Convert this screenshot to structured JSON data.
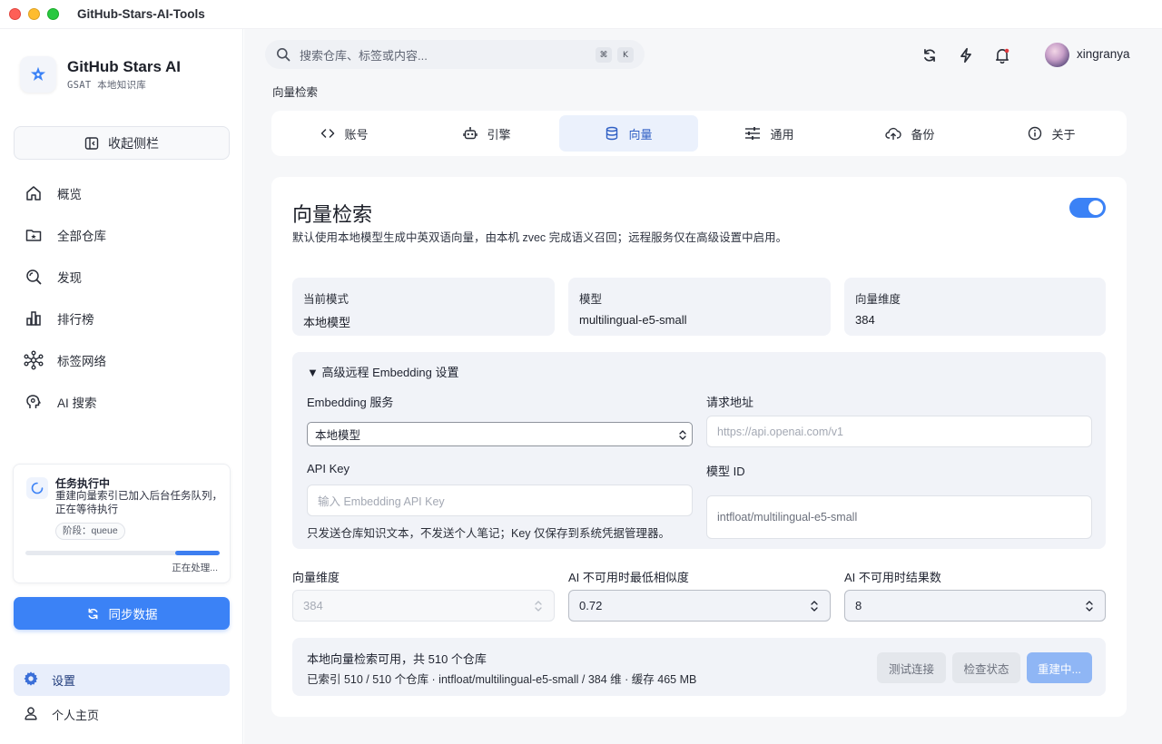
{
  "window": {
    "title": "GitHub-Stars-AI-Tools"
  },
  "brand": {
    "name": "GitHub Stars AI",
    "subtitle": "GSAT 本地知识库",
    "icon": "star-sparkle-icon"
  },
  "sidebar": {
    "collapse_label": "收起侧栏",
    "items": [
      {
        "label": "概览",
        "icon": "home-icon"
      },
      {
        "label": "全部仓库",
        "icon": "folder-star-icon"
      },
      {
        "label": "发现",
        "icon": "discover-search-icon"
      },
      {
        "label": "排行榜",
        "icon": "bar-chart-icon"
      },
      {
        "label": "标签网络",
        "icon": "network-icon"
      },
      {
        "label": "AI 搜索",
        "icon": "ai-brain-icon"
      }
    ],
    "task": {
      "title": "任务执行中",
      "description": "重建向量索引已加入后台任务队列，正在等待执行",
      "stage": "阶段：queue",
      "status": "正在处理..."
    },
    "sync_label": "同步数据",
    "bottom": [
      {
        "label": "设置",
        "icon": "gear-icon",
        "active": true
      },
      {
        "label": "个人主页",
        "icon": "user-icon",
        "active": false
      }
    ]
  },
  "topbar": {
    "search_placeholder": "搜索仓库、标签或内容...",
    "shortcut_mod": "⌘",
    "shortcut_key": "K",
    "username": "xingranya"
  },
  "breadcrumb": "向量检索",
  "tabs": [
    {
      "label": "账号",
      "icon": "code-icon"
    },
    {
      "label": "引擎",
      "icon": "robot-icon"
    },
    {
      "label": "向量",
      "icon": "database-icon",
      "active": true
    },
    {
      "label": "通用",
      "icon": "sliders-icon"
    },
    {
      "label": "备份",
      "icon": "cloud-upload-icon"
    },
    {
      "label": "关于",
      "icon": "info-icon"
    }
  ],
  "panel": {
    "title": "向量检索",
    "description": "默认使用本地模型生成中英双语向量，由本机 zvec 完成语义召回；远程服务仅在高级设置中启用。",
    "enabled": true,
    "stats": [
      {
        "label": "当前模式",
        "value": "本地模型"
      },
      {
        "label": "模型",
        "value": "multilingual-e5-small"
      },
      {
        "label": "向量维度",
        "value": "384"
      }
    ],
    "advanced": {
      "summary": "▼ 高级远程 Embedding 设置",
      "service_label": "Embedding 服务",
      "service_value": "本地模型",
      "url_label": "请求地址",
      "url_placeholder": "https://api.openai.com/v1",
      "apikey_label": "API Key",
      "apikey_placeholder": "输入 Embedding API Key",
      "model_label": "模型 ID",
      "model_value": "intfloat/multilingual-e5-small",
      "note": "只发送仓库知识文本，不发送个人笔记；Key 仅保存到系统凭据管理器。"
    },
    "numbers": [
      {
        "label": "向量维度",
        "value": "384",
        "disabled": true
      },
      {
        "label": "AI 不可用时最低相似度",
        "value": "0.72",
        "disabled": false
      },
      {
        "label": "AI 不可用时结果数",
        "value": "8",
        "disabled": false
      }
    ],
    "status": {
      "main": "本地向量检索可用，共 510 个仓库",
      "sub": "已索引 510 / 510 个仓库 · intfloat/multilingual-e5-small / 384 维 · 缓存 465 MB",
      "test_label": "测试连接",
      "check_label": "检查状态",
      "rebuild_label": "重建中..."
    }
  },
  "colors": {
    "accent": "#3b82f6",
    "accent_light": "#8fb6f5",
    "card_bg": "#f1f3f8"
  }
}
